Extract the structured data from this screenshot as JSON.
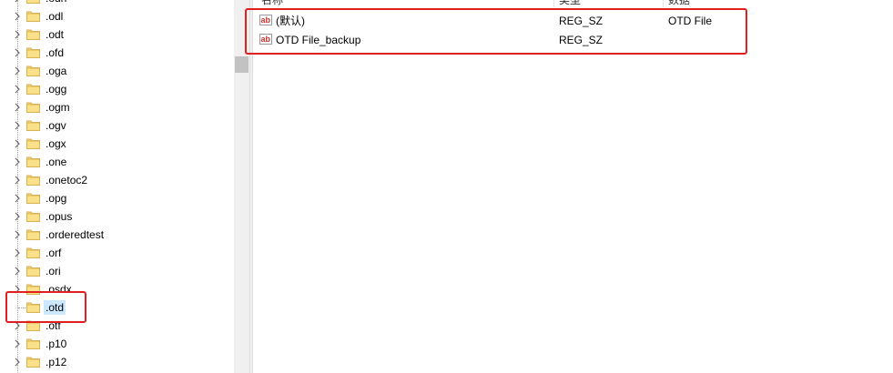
{
  "tree": {
    "items": [
      {
        "label": ".odh"
      },
      {
        "label": ".odl"
      },
      {
        "label": ".odt"
      },
      {
        "label": ".ofd"
      },
      {
        "label": ".oga"
      },
      {
        "label": ".ogg"
      },
      {
        "label": ".ogm"
      },
      {
        "label": ".ogv"
      },
      {
        "label": ".ogx"
      },
      {
        "label": ".one"
      },
      {
        "label": ".onetoc2"
      },
      {
        "label": ".opg"
      },
      {
        "label": ".opus"
      },
      {
        "label": ".orderedtest"
      },
      {
        "label": ".orf"
      },
      {
        "label": ".ori"
      },
      {
        "label": ".osdx"
      },
      {
        "label": ".otd",
        "selected": true
      },
      {
        "label": ".otf"
      },
      {
        "label": ".p10"
      },
      {
        "label": ".p12"
      }
    ]
  },
  "list": {
    "columns": {
      "name": "名称",
      "type": "类型",
      "data": "数据"
    },
    "rows": [
      {
        "name": "(默认)",
        "type": "REG_SZ",
        "data": "OTD File",
        "icon": "string-value-icon"
      },
      {
        "name": "OTD File_backup",
        "type": "REG_SZ",
        "data": "",
        "icon": "string-value-icon"
      }
    ]
  },
  "colors": {
    "highlight_box": "#e02020",
    "selection": "#cce8ff",
    "folder": "#f8d775"
  }
}
